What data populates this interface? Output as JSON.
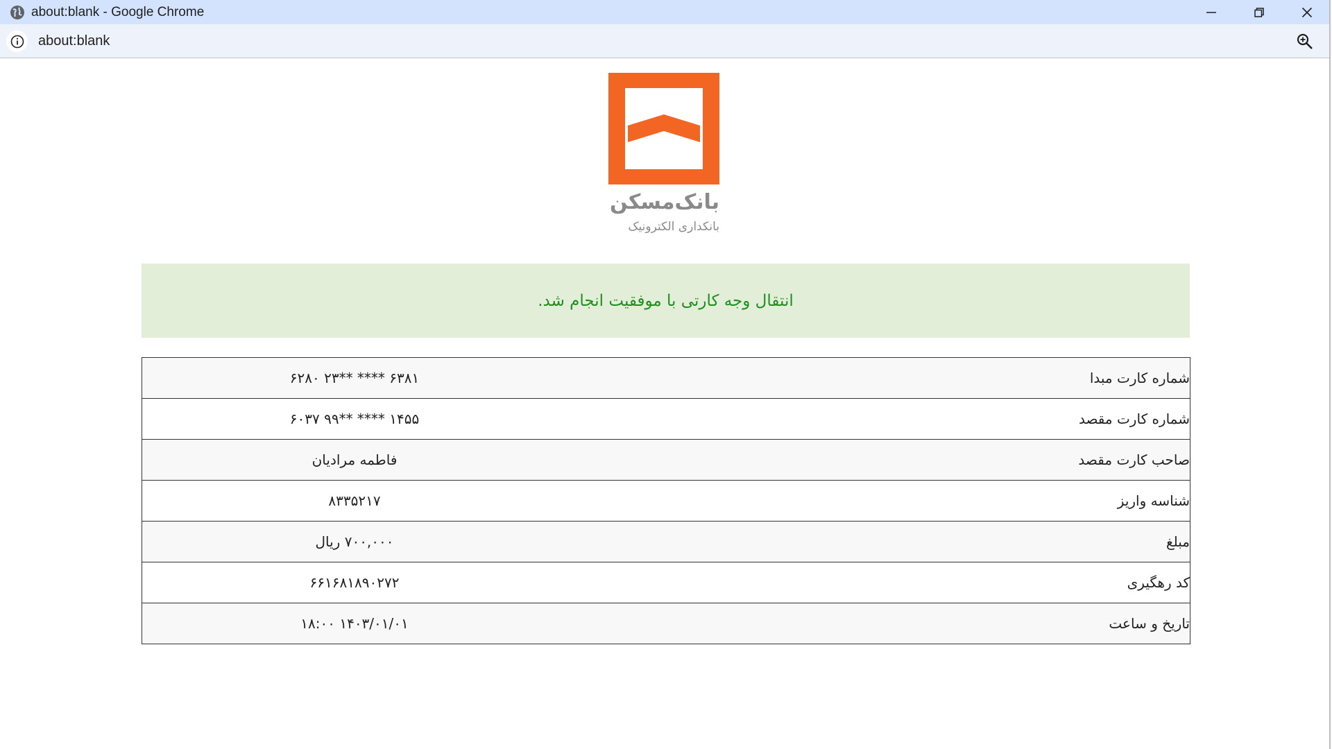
{
  "window": {
    "title": "about:blank - Google Chrome",
    "controls": {
      "minimize": "minimize-icon",
      "restore": "restore-icon",
      "close": "close-icon"
    }
  },
  "addressbar": {
    "url": "about:blank",
    "site_info_icon": "info-icon",
    "zoom_icon": "zoom-icon"
  },
  "logo": {
    "name": "بانک‌مسکن",
    "subtitle": "بانکداری الکترونیک",
    "color": "#f26522"
  },
  "alert": {
    "message": "انتقال وجه کارتی با موفقیت انجام شد.",
    "text_color": "#1f8f1f",
    "background": "#e2eed8"
  },
  "details": [
    {
      "label": "شماره کارت مبدا",
      "value": "۶۳۸۱ **** **۲۳ ۶۲۸۰"
    },
    {
      "label": "شماره کارت مقصد",
      "value": "۱۴۵۵ **** **۹۹ ۶۰۳۷"
    },
    {
      "label": "صاحب کارت مقصد",
      "value": "فاطمه مرادیان"
    },
    {
      "label": "شناسه واریز",
      "value": "۸۳۳۵۲۱۷"
    },
    {
      "label": "مبلغ",
      "value": "۷۰۰,۰۰۰ ریال"
    },
    {
      "label": "کد رهگیری",
      "value": "۶۶۱۶۸۱۸۹۰۲۷۲"
    },
    {
      "label": "تاریخ و ساعت",
      "value": "۱۴۰۳/۰۱/۰۱ ۱۸:۰۰"
    }
  ]
}
